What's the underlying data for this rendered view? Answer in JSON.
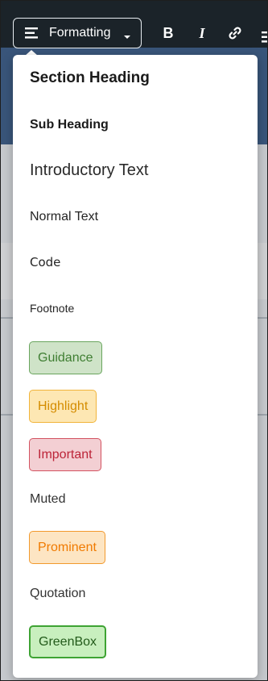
{
  "toolbar": {
    "formatting_label": "Formatting",
    "bold_label": "B",
    "italic_label": "I",
    "icons": [
      "menu-lines-icon",
      "caret-down-icon",
      "bold-icon",
      "italic-icon",
      "link-icon"
    ]
  },
  "menu": {
    "items": [
      {
        "label": "Section Heading",
        "style": "section-heading"
      },
      {
        "label": "Sub Heading",
        "style": "sub-heading"
      },
      {
        "label": "Introductory Text",
        "style": "introductory-text"
      },
      {
        "label": "Normal Text",
        "style": "normal-text"
      },
      {
        "label": "Code",
        "style": "code"
      },
      {
        "label": "Footnote",
        "style": "footnote"
      },
      {
        "label": "Guidance",
        "style": "guidance",
        "color": "#3f7e32",
        "background": "#cfe3c8"
      },
      {
        "label": "Highlight",
        "style": "highlight",
        "color": "#d48c00",
        "background": "#fde7b3"
      },
      {
        "label": "Important",
        "style": "important",
        "color": "#bc2438",
        "background": "#f3cfd3"
      },
      {
        "label": "Muted",
        "style": "muted"
      },
      {
        "label": "Prominent",
        "style": "prominent",
        "color": "#f07a00",
        "background": "#fde5c3"
      },
      {
        "label": "Quotation",
        "style": "quotation"
      },
      {
        "label": "GreenBox",
        "style": "greenbox",
        "color": "#225a1a",
        "background": "#c8efbe"
      }
    ]
  },
  "colors": {
    "toolbar_background": "#1b2329",
    "menu_background": "#ffffff"
  }
}
